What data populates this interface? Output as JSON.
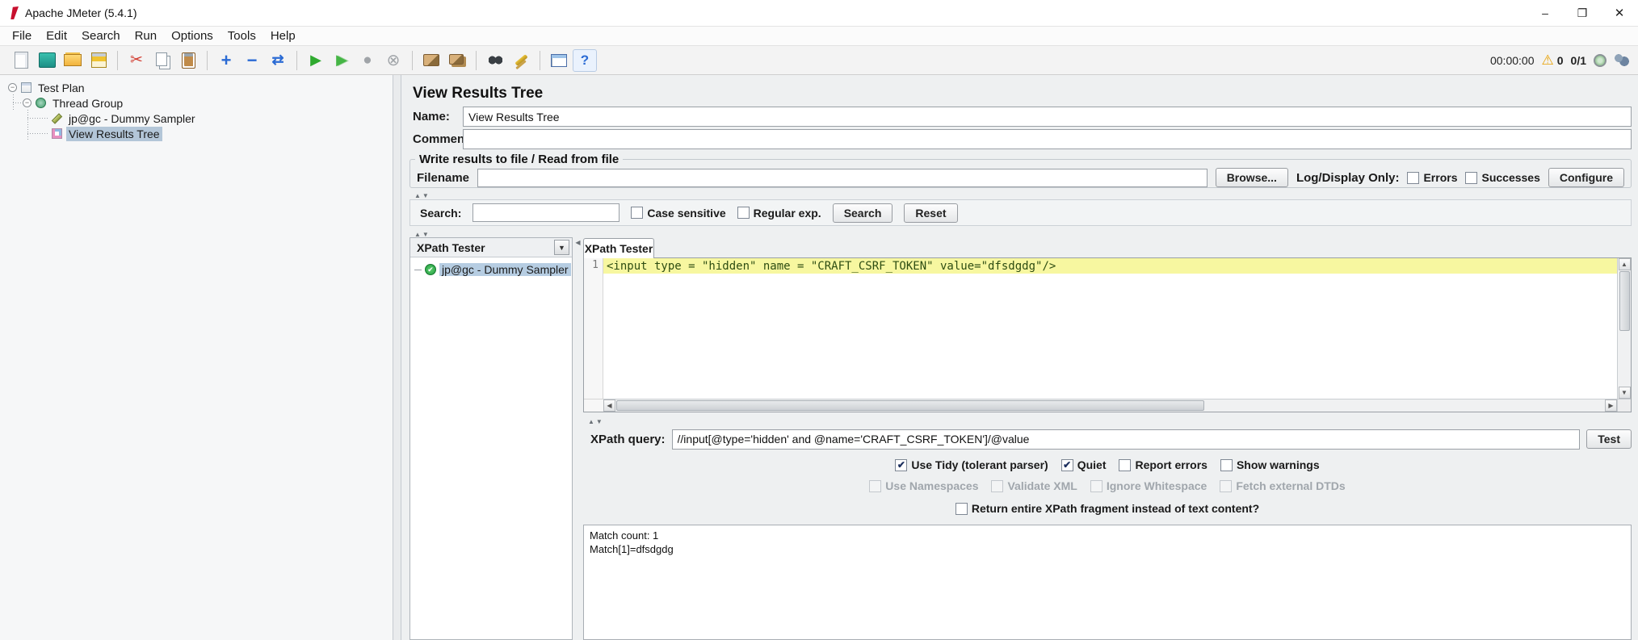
{
  "colors": {
    "selection": "#b8cfe5",
    "line_highlight": "#f7f7a0",
    "warning": "#e8a000",
    "run_green": "#2faa2f"
  },
  "window": {
    "title": "Apache JMeter (5.4.1)",
    "minimize": "–",
    "maximize": "❐",
    "close": "✕"
  },
  "menubar": {
    "items": [
      {
        "label": "File"
      },
      {
        "label": "Edit"
      },
      {
        "label": "Search"
      },
      {
        "label": "Run"
      },
      {
        "label": "Options"
      },
      {
        "label": "Tools"
      },
      {
        "label": "Help"
      }
    ]
  },
  "toolbar": {
    "icons": [
      {
        "name": "new-file-icon"
      },
      {
        "name": "templates-icon"
      },
      {
        "name": "open-file-icon"
      },
      {
        "name": "save-icon"
      },
      {
        "name": "cut-icon"
      },
      {
        "name": "copy-icon"
      },
      {
        "name": "paste-icon"
      },
      {
        "name": "expand-all-icon"
      },
      {
        "name": "collapse-all-icon"
      },
      {
        "name": "toggle-icon"
      },
      {
        "name": "start-icon"
      },
      {
        "name": "start-no-pauses-icon"
      },
      {
        "name": "stop-icon"
      },
      {
        "name": "shutdown-icon"
      },
      {
        "name": "clear-icon"
      },
      {
        "name": "clear-all-icon"
      },
      {
        "name": "search-icon"
      },
      {
        "name": "search-reset-icon"
      },
      {
        "name": "function-helper-icon"
      },
      {
        "name": "help-icon"
      }
    ],
    "timer": "00:00:00",
    "error_count": "0",
    "thread_count": "0/1"
  },
  "tree": {
    "items": [
      {
        "label": "Test Plan"
      },
      {
        "label": "Thread Group"
      },
      {
        "label": "jp@gc - Dummy Sampler"
      },
      {
        "label": "View Results Tree"
      }
    ]
  },
  "main": {
    "title": "View Results Tree",
    "name": {
      "label": "Name:",
      "value": "View Results Tree"
    },
    "comments": {
      "label": "Comments:",
      "value": ""
    },
    "file_group": {
      "title": "Write results to file / Read from file",
      "filename_label": "Filename",
      "filename_value": "",
      "browse_button": "Browse...",
      "log_display_label": "Log/Display Only:",
      "errors": {
        "label": "Errors",
        "check": ""
      },
      "successes": {
        "label": "Successes",
        "check": ""
      },
      "configure_button": "Configure"
    },
    "search": {
      "label": "Search:",
      "value": "",
      "case_sensitive": {
        "label": "Case sensitive",
        "check": ""
      },
      "regular_exp": {
        "label": "Regular exp.",
        "check": ""
      },
      "search_button": "Search",
      "reset_button": "Reset"
    },
    "selector": {
      "header": "XPath Tester",
      "item": "jp@gc - Dummy Sampler"
    },
    "xpath": {
      "tab": "XPath Tester",
      "line_number": "1",
      "code": "<input type = \"hidden\" name = \"CRAFT_CSRF_TOKEN\" value=\"dfsdgdg\"/>",
      "query_label": "XPath query:",
      "query_value": "//input[@type='hidden' and @name='CRAFT_CSRF_TOKEN']/@value",
      "test_button": "Test",
      "row1": [
        {
          "label": "Use Tidy (tolerant parser)",
          "check": "✔"
        },
        {
          "label": "Quiet",
          "check": "✔"
        },
        {
          "label": "Report errors",
          "check": ""
        },
        {
          "label": "Show warnings",
          "check": ""
        }
      ],
      "row2": [
        {
          "label": "Use Namespaces",
          "check": ""
        },
        {
          "label": "Validate XML",
          "check": ""
        },
        {
          "label": "Ignore Whitespace",
          "check": ""
        },
        {
          "label": "Fetch external DTDs",
          "check": ""
        }
      ],
      "return_fragment": {
        "label": "Return entire XPath fragment instead of text content?",
        "check": ""
      },
      "results": [
        "Match count: 1",
        "Match[1]=dfsdgdg"
      ]
    }
  }
}
